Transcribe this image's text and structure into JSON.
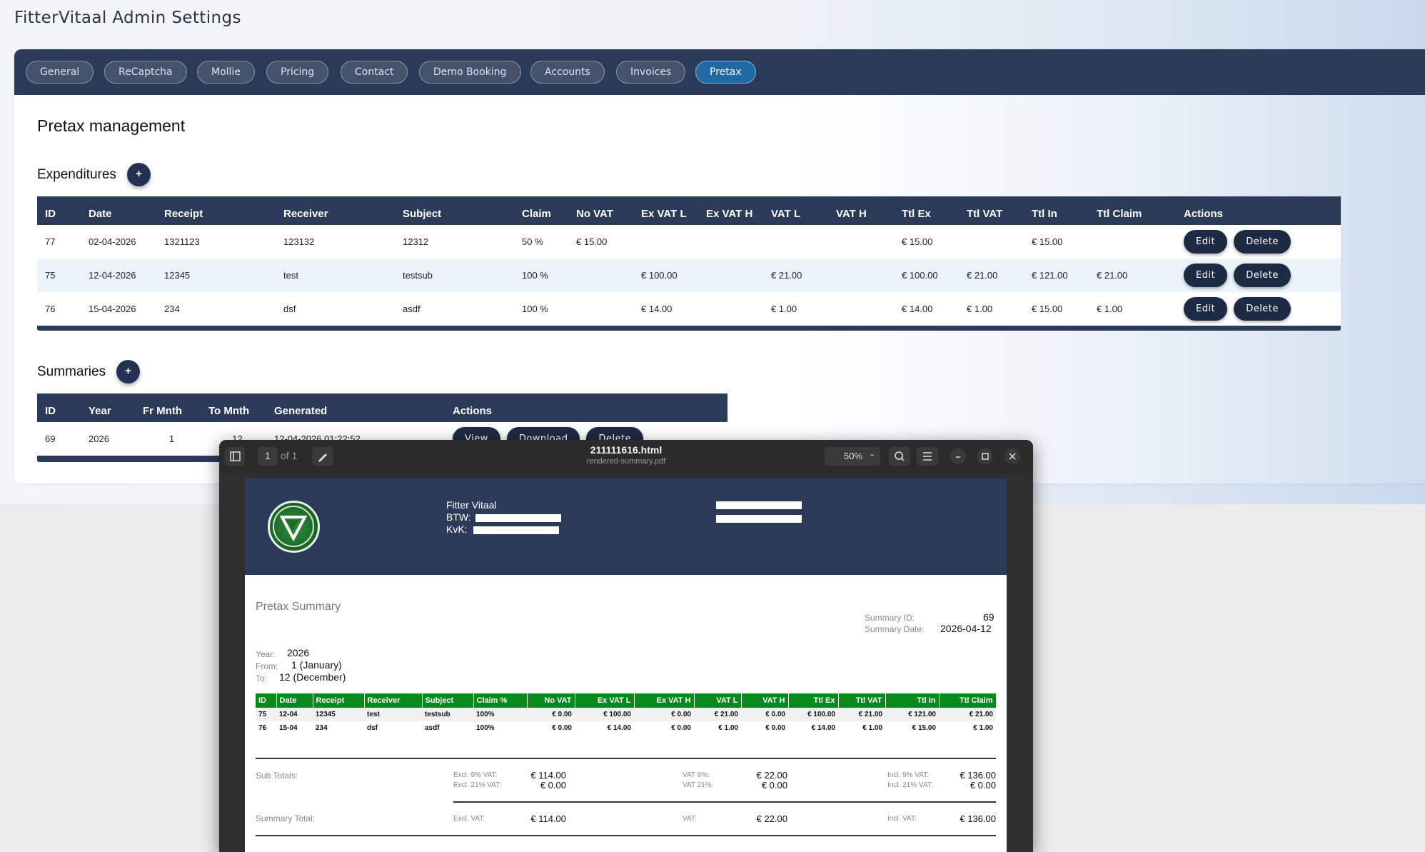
{
  "app_title": "FitterVitaal Admin Settings",
  "tabs": [
    {
      "label": "General",
      "active": false
    },
    {
      "label": "ReCaptcha",
      "active": false
    },
    {
      "label": "Mollie",
      "active": false
    },
    {
      "label": "Pricing",
      "active": false
    },
    {
      "label": "Contact",
      "active": false
    },
    {
      "label": "Demo Booking",
      "active": false
    },
    {
      "label": "Accounts",
      "active": false
    },
    {
      "label": "Invoices",
      "active": false
    },
    {
      "label": "Pretax",
      "active": true
    }
  ],
  "section_title": "Pretax management",
  "add_icon": "+",
  "expenditures": {
    "title": "Expenditures",
    "columns": [
      "ID",
      "Date",
      "Receipt",
      "Receiver",
      "Subject",
      "Claim",
      "No VAT",
      "Ex VAT L",
      "Ex VAT H",
      "VAT L",
      "VAT H",
      "Ttl Ex",
      "Ttl VAT",
      "Ttl In",
      "Ttl Claim",
      "Actions"
    ],
    "rows": [
      [
        "77",
        "02-04-2026",
        "1321123",
        "123132",
        "12312",
        "50 %",
        "€ 15.00",
        "",
        "",
        "",
        "",
        "€ 15.00",
        "",
        "€ 15.00",
        ""
      ],
      [
        "75",
        "12-04-2026",
        "12345",
        "test",
        "testsub",
        "100 %",
        "",
        "€ 100.00",
        "",
        "€ 21.00",
        "",
        "€ 100.00",
        "€ 21.00",
        "€ 121.00",
        "€ 21.00"
      ],
      [
        "76",
        "15-04-2026",
        "234",
        "dsf",
        "asdf",
        "100 %",
        "",
        "€ 14.00",
        "",
        "€ 1.00",
        "",
        "€ 14.00",
        "€ 1.00",
        "€ 15.00",
        "€ 1.00"
      ]
    ],
    "edit_label": "Edit",
    "delete_label": "Delete"
  },
  "summaries": {
    "title": "Summaries",
    "columns": [
      "ID",
      "Year",
      "Fr Mnth",
      "To Mnth",
      "Generated",
      "Actions"
    ],
    "rows": [
      [
        "69",
        "2026",
        "1",
        "12",
        "12-04-2026 01:22:52"
      ]
    ],
    "view_label": "View",
    "download_label": "Download",
    "delete_label": "Delete"
  },
  "viewer": {
    "page_current": "1",
    "page_of": "of 1",
    "file_title": "211111616.html",
    "file_subtitle": "rendered-summary.pdf",
    "zoom": "50%"
  },
  "pdf": {
    "company_name": "Fitter Vitaal",
    "btw_label": "BTW:",
    "kvk_label": "KvK:",
    "title": "Pretax Summary",
    "summary_id_label": "Summary ID:",
    "summary_id": "69",
    "summary_date_label": "Summary Date:",
    "summary_date": "2026-04-12",
    "year_label": "Year:",
    "year": "2026",
    "from_label": "From:",
    "from": "1 (January)",
    "to_label": "To:",
    "to": "12 (December)",
    "columns": [
      "ID",
      "Date",
      "Receipt",
      "Receiver",
      "Subject",
      "Claim %",
      "No VAT",
      "Ex VAT L",
      "Ex VAT H",
      "VAT L",
      "VAT H",
      "Ttl Ex",
      "Ttl VAT",
      "Ttl In",
      "Ttl Claim"
    ],
    "rows": [
      [
        "75",
        "12-04",
        "12345",
        "test",
        "testsub",
        "100%",
        "€ 0.00",
        "€ 100.00",
        "€ 0.00",
        "€ 21.00",
        "€ 0.00",
        "€ 100.00",
        "€ 21.00",
        "€ 121.00",
        "€ 21.00"
      ],
      [
        "76",
        "15-04",
        "234",
        "dsf",
        "asdf",
        "100%",
        "€ 0.00",
        "€ 14.00",
        "€ 0.00",
        "€ 1.00",
        "€ 0.00",
        "€ 14.00",
        "€ 1.00",
        "€ 15.00",
        "€ 1.00"
      ]
    ],
    "subtotals_label": "Sub Totals:",
    "excl9_label": "Excl. 9% VAT:",
    "excl9": "€ 114.00",
    "excl21_label": "Excl. 21% VAT:",
    "excl21": "€ 0.00",
    "vat9_label": "VAT 9%:",
    "vat9": "€ 22.00",
    "vat21_label": "VAT 21%:",
    "vat21": "€ 0.00",
    "incl9_label": "Incl. 9% VAT:",
    "incl9": "€ 136.00",
    "incl21_label": "Incl. 21% VAT:",
    "incl21": "€ 0.00",
    "total_label": "Summary Total:",
    "excl_label": "Excl. VAT:",
    "excl": "€ 114.00",
    "vat_label": "VAT:",
    "vat": "€ 22.00",
    "incl_label": "Incl. VAT:",
    "incl": "€ 136.00"
  }
}
